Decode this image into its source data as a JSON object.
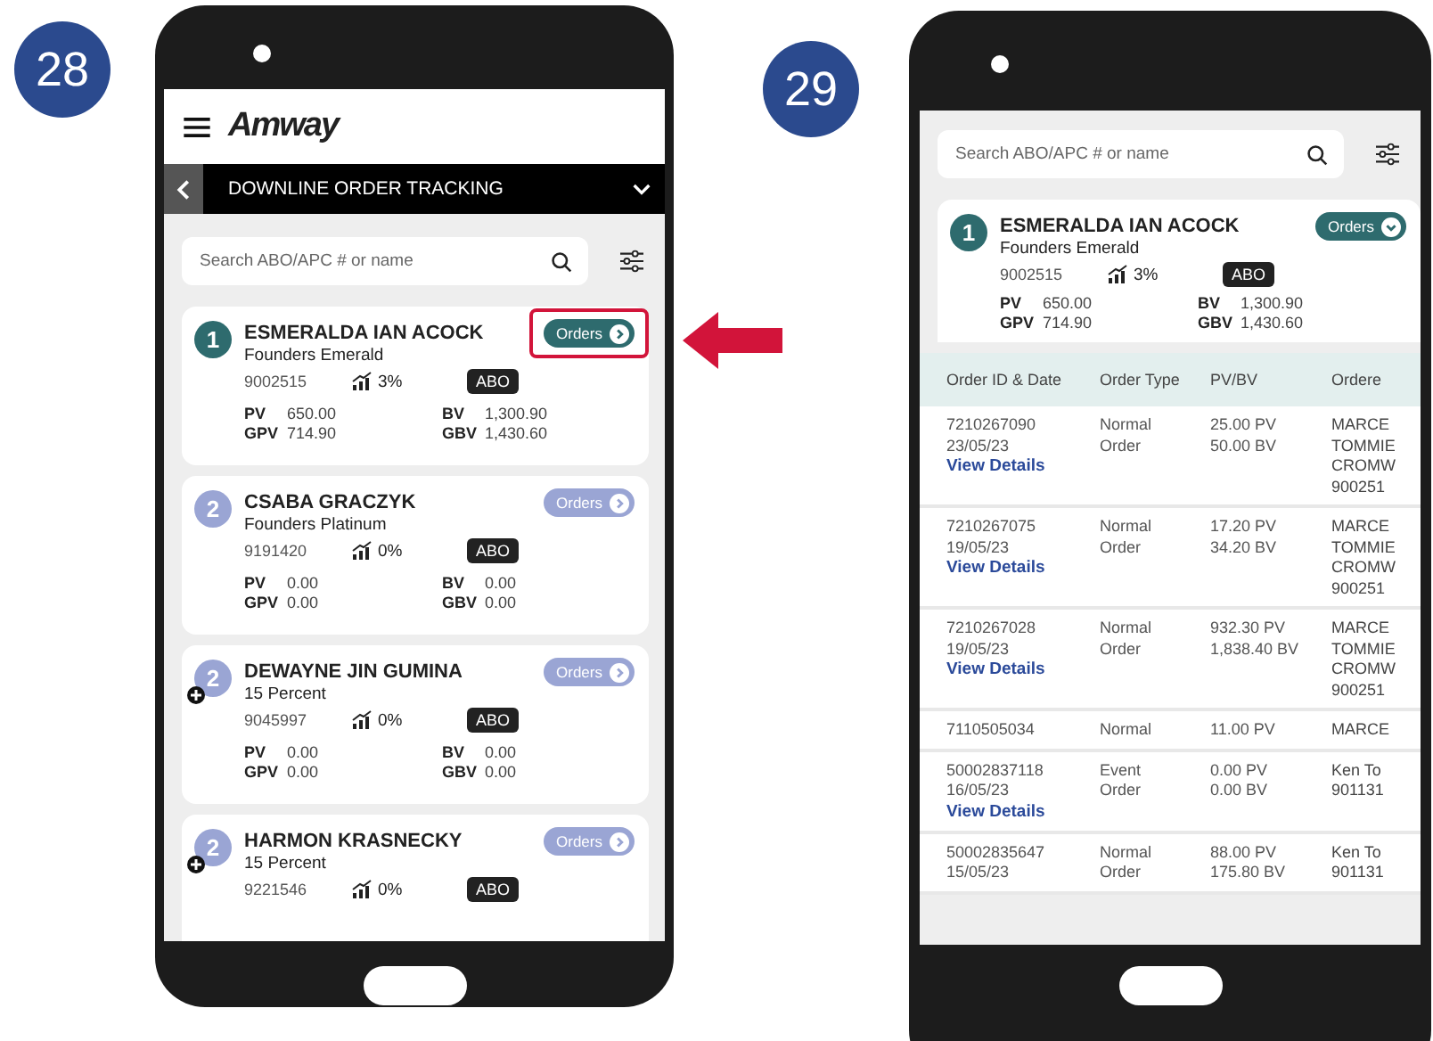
{
  "left_panel": {
    "step": "28",
    "logo": "Amway",
    "nav_title": "DOWNLINE ORDER TRACKING",
    "search": {
      "placeholder": "Search ABO/APC # or name"
    },
    "cards": [
      {
        "rank": "1",
        "plus": false,
        "selected": true,
        "highlighted": true,
        "expanded": false,
        "name": "ESMERALDA IAN ACOCK",
        "level": "Founders Emerald",
        "id": "9002515",
        "growth": "3%",
        "type": "ABO",
        "orders": "Orders",
        "stats": [
          {
            "label": "PV",
            "value": "650.00"
          },
          {
            "label": "BV",
            "value": "1,300.90"
          },
          {
            "label": "GPV",
            "value": "714.90"
          },
          {
            "label": "GBV",
            "value": "1,430.60"
          }
        ]
      },
      {
        "rank": "2",
        "plus": false,
        "selected": false,
        "expanded": false,
        "name": "CSABA GRACZYK",
        "level": "Founders Platinum",
        "id": "9191420",
        "growth": "0%",
        "type": "ABO",
        "orders": "Orders",
        "stats": [
          {
            "label": "PV",
            "value": "0.00"
          },
          {
            "label": "BV",
            "value": "0.00"
          },
          {
            "label": "GPV",
            "value": "0.00"
          },
          {
            "label": "GBV",
            "value": "0.00"
          }
        ]
      },
      {
        "rank": "2",
        "plus": true,
        "selected": false,
        "expanded": false,
        "name": "DEWAYNE JIN GUMINA",
        "level": "15 Percent",
        "id": "9045997",
        "growth": "0%",
        "type": "ABO",
        "orders": "Orders",
        "stats": [
          {
            "label": "PV",
            "value": "0.00"
          },
          {
            "label": "BV",
            "value": "0.00"
          },
          {
            "label": "GPV",
            "value": "0.00"
          },
          {
            "label": "GBV",
            "value": "0.00"
          }
        ]
      },
      {
        "rank": "2",
        "plus": true,
        "selected": false,
        "expanded": false,
        "name": "HARMON KRASNECKY",
        "level": "15 Percent",
        "id": "9221546",
        "growth": "0%",
        "type": "ABO",
        "orders": "Orders"
      }
    ]
  },
  "right_panel": {
    "step": "29",
    "search": {
      "placeholder": "Search ABO/APC # or name"
    },
    "card": {
      "rank": "1",
      "plus": false,
      "selected": true,
      "expanded": true,
      "name": "ESMERALDA IAN ACOCK",
      "level": "Founders Emerald",
      "id": "9002515",
      "growth": "3%",
      "type": "ABO",
      "orders": "Orders",
      "stats": [
        {
          "label": "PV",
          "value": "650.00"
        },
        {
          "label": "BV",
          "value": "1,300.90"
        },
        {
          "label": "GPV",
          "value": "714.90"
        },
        {
          "label": "GBV",
          "value": "1,430.60"
        }
      ]
    },
    "table": {
      "columns": [
        "Order ID & Date",
        "Order Type",
        "PV/BV",
        "Ordere"
      ],
      "rows": [
        {
          "id": "7210267090",
          "date": "23/05/23",
          "link": "View Details",
          "type": "Normal Order",
          "pv_bv": [
            "25.00 PV",
            "50.00 BV"
          ],
          "ordered_by": [
            "MARCE",
            "TOMMIE",
            "CROMW",
            "900251"
          ]
        },
        {
          "id": "7210267075",
          "date": "19/05/23",
          "link": "View Details",
          "type": "Normal Order",
          "pv_bv": [
            "17.20 PV",
            "34.20 BV"
          ],
          "ordered_by": [
            "MARCE",
            "TOMMIE",
            "CROMW",
            "900251"
          ]
        },
        {
          "id": "7210267028",
          "date": "19/05/23",
          "link": "View Details",
          "type": "Normal Order",
          "pv_bv": [
            "932.30 PV",
            "1,838.40 BV"
          ],
          "ordered_by": [
            "MARCE",
            "TOMMIE",
            "CROMW",
            "900251"
          ]
        },
        {
          "id": "7110505034",
          "type": "Normal",
          "pv_bv": [
            "11.00 PV"
          ],
          "ordered_by": [
            "MARCE"
          ]
        },
        {
          "id": "50002837118",
          "date": "16/05/23",
          "link": "View Details",
          "type": "Event Order",
          "pv_bv": [
            "0.00 PV",
            "0.00 BV"
          ],
          "ordered_by": [
            "Ken To",
            "901131"
          ]
        },
        {
          "id": "50002835647",
          "date": "15/05/23",
          "type": "Normal Order",
          "pv_bv": [
            "88.00 PV",
            "175.80 BV"
          ],
          "ordered_by": [
            "Ken To",
            "901131"
          ]
        }
      ]
    }
  }
}
